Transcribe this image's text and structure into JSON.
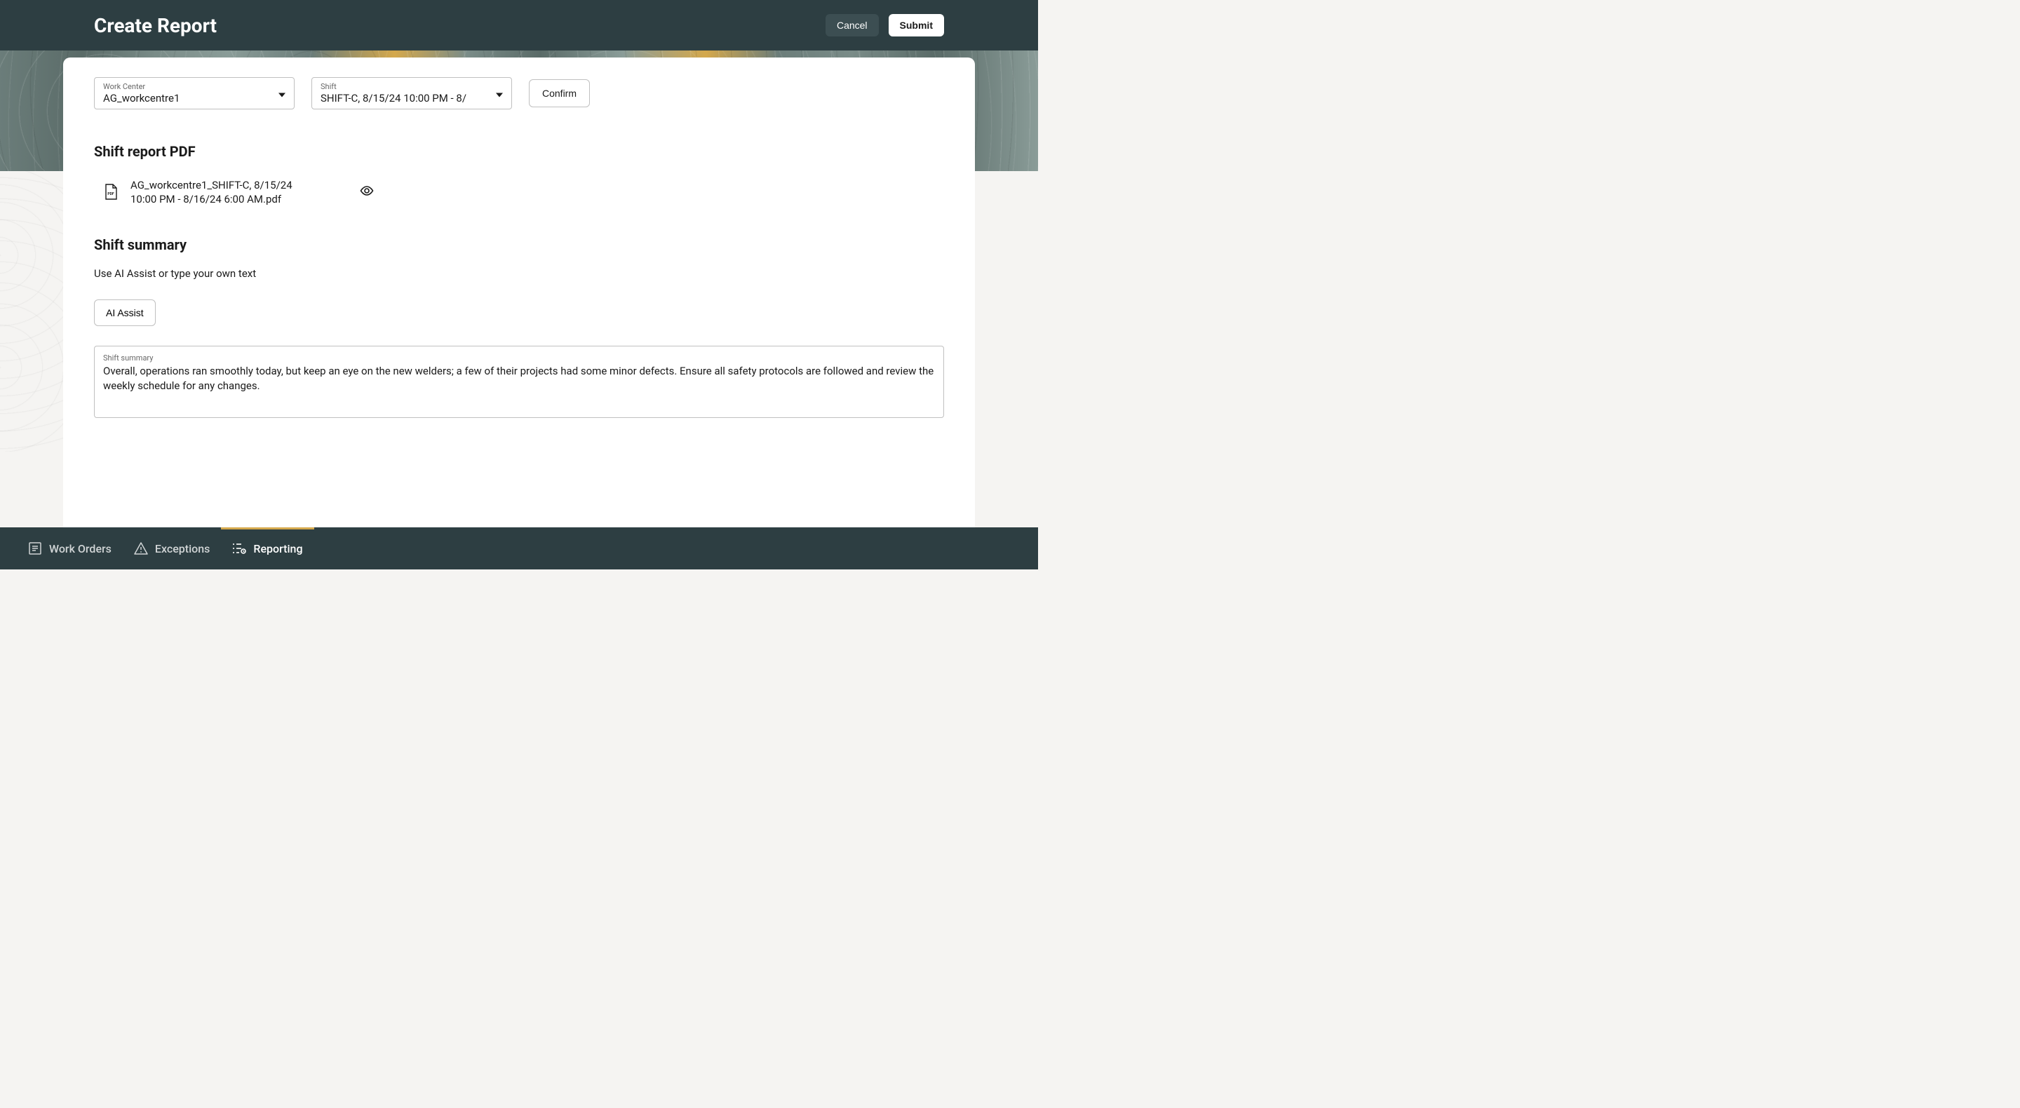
{
  "header": {
    "title": "Create Report",
    "cancel_label": "Cancel",
    "submit_label": "Submit"
  },
  "filters": {
    "work_center": {
      "label": "Work Center",
      "value": "AG_workcentre1"
    },
    "shift": {
      "label": "Shift",
      "value": "SHIFT-C, 8/15/24 10:00 PM - 8/"
    },
    "confirm_label": "Confirm"
  },
  "sections": {
    "pdf": {
      "heading": "Shift report PDF",
      "filename": "AG_workcentre1_SHIFT-C, 8/15/24 10:00 PM - 8/16/24 6:00 AM.pdf"
    },
    "summary": {
      "heading": "Shift summary",
      "hint": "Use AI Assist or type your own text",
      "ai_assist_label": "AI Assist",
      "field_label": "Shift summary",
      "field_value": "Overall, operations ran smoothly today, but keep an eye on the new welders; a few of their projects had some minor defects. Ensure all safety protocols are followed and review the weekly schedule for any changes."
    }
  },
  "bottom_nav": {
    "work_orders": "Work Orders",
    "exceptions": "Exceptions",
    "reporting": "Reporting"
  }
}
